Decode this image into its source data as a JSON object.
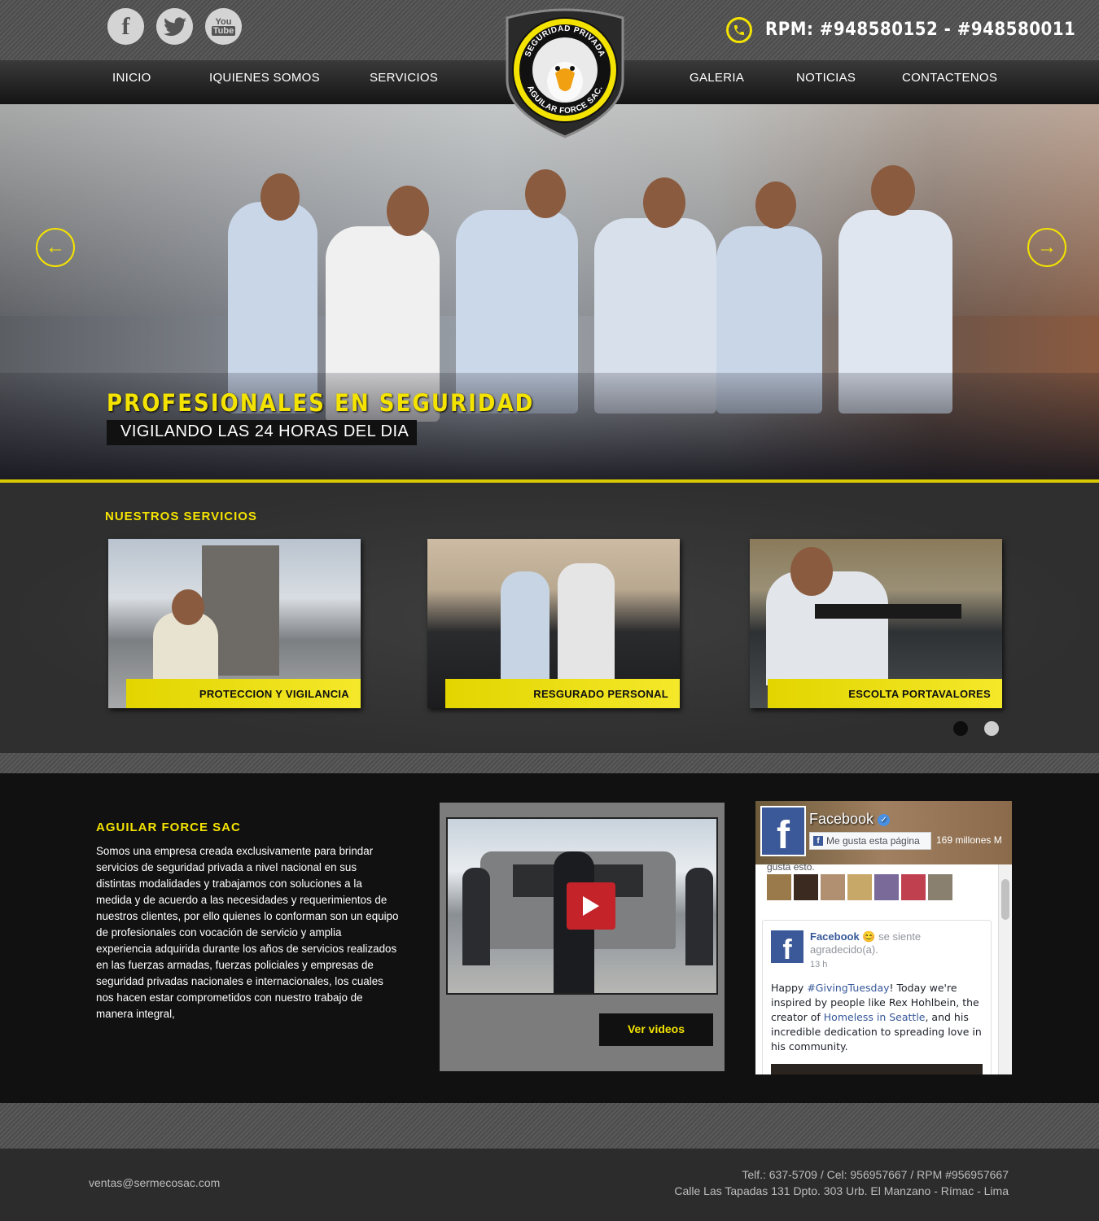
{
  "header": {
    "social": {
      "facebook": "f",
      "youtube_line1": "You",
      "youtube_line2": "Tube"
    },
    "phone": "RPM: #948580152 - #948580011",
    "logo": {
      "top_text": "SEGURIDAD PRIVADA",
      "bottom_text": "AGUILAR FORCE SAC."
    }
  },
  "nav": {
    "items": [
      "INICIO",
      "IQUIENES SOMOS",
      "SERVICIOS",
      "GALERIA",
      "NOTICIAS",
      "CONTACTENOS"
    ]
  },
  "hero": {
    "title": "PROFESIONALES  EN  SEGURIDAD",
    "subtitle": "VIGILANDO LAS  24  HORAS  DEL DIA",
    "prev_icon": "arrow-left-icon",
    "next_icon": "arrow-right-icon"
  },
  "services": {
    "title": "NUESTROS  SERVICIOS",
    "cards": [
      {
        "caption": "PROTECCION Y  VIGILANCIA"
      },
      {
        "caption": "RESGURADO PERSONAL"
      },
      {
        "caption": "ESCOLTA PORTAVALORES"
      }
    ],
    "pager_active": 1,
    "pager_total": 2
  },
  "about": {
    "title": "AGUILAR  FORCE  SAC",
    "text": "Somos una empresa creada exclusivamente para brindar servicios  de seguridad privada a nivel nacional en sus distintas modalidades y trabajamos con soluciones a la medida y de acuerdo a las necesidades y requerimientos de nuestros clientes, por ello quienes lo conforman son un equipo de profesionales con vocación de servicio y amplia experiencia adquirida durante los años de servicios realizados en las fuerzas armadas, fuerzas policiales y empresas de seguridad privadas nacionales e internacionales,   los  cuales nos hacen estar comprometidos con nuestro trabajo de manera integral,"
  },
  "video": {
    "button_label": "Ver videos"
  },
  "facebook_widget": {
    "page_name": "Facebook",
    "like_label": "Me gusta esta página",
    "likes_count": "169 millones M",
    "likes_text": "gusta esto.",
    "post": {
      "author": "Facebook",
      "feeling": "se siente agradecido(a).",
      "time": "13 h",
      "text_1": "Happy ",
      "hashtag": "#GivingTuesday",
      "text_2": "! Today we're inspired by people like Rex Hohlbein, the creator of ",
      "link": "Homeless in Seattle",
      "text_3": ", and his incredible dedication to spreading love in his community."
    }
  },
  "footer": {
    "email": "ventas@sermecosac.com",
    "phones": "Telf.: 637-5709 / Cel: 956957667 / RPM #956957667",
    "address": "Calle Las Tapadas 131 Dpto. 303 Urb. El Manzano - Rímac - Lima"
  },
  "colors": {
    "accent": "#f4e300",
    "dark": "#111111",
    "facebook_blue": "#3b5998"
  }
}
